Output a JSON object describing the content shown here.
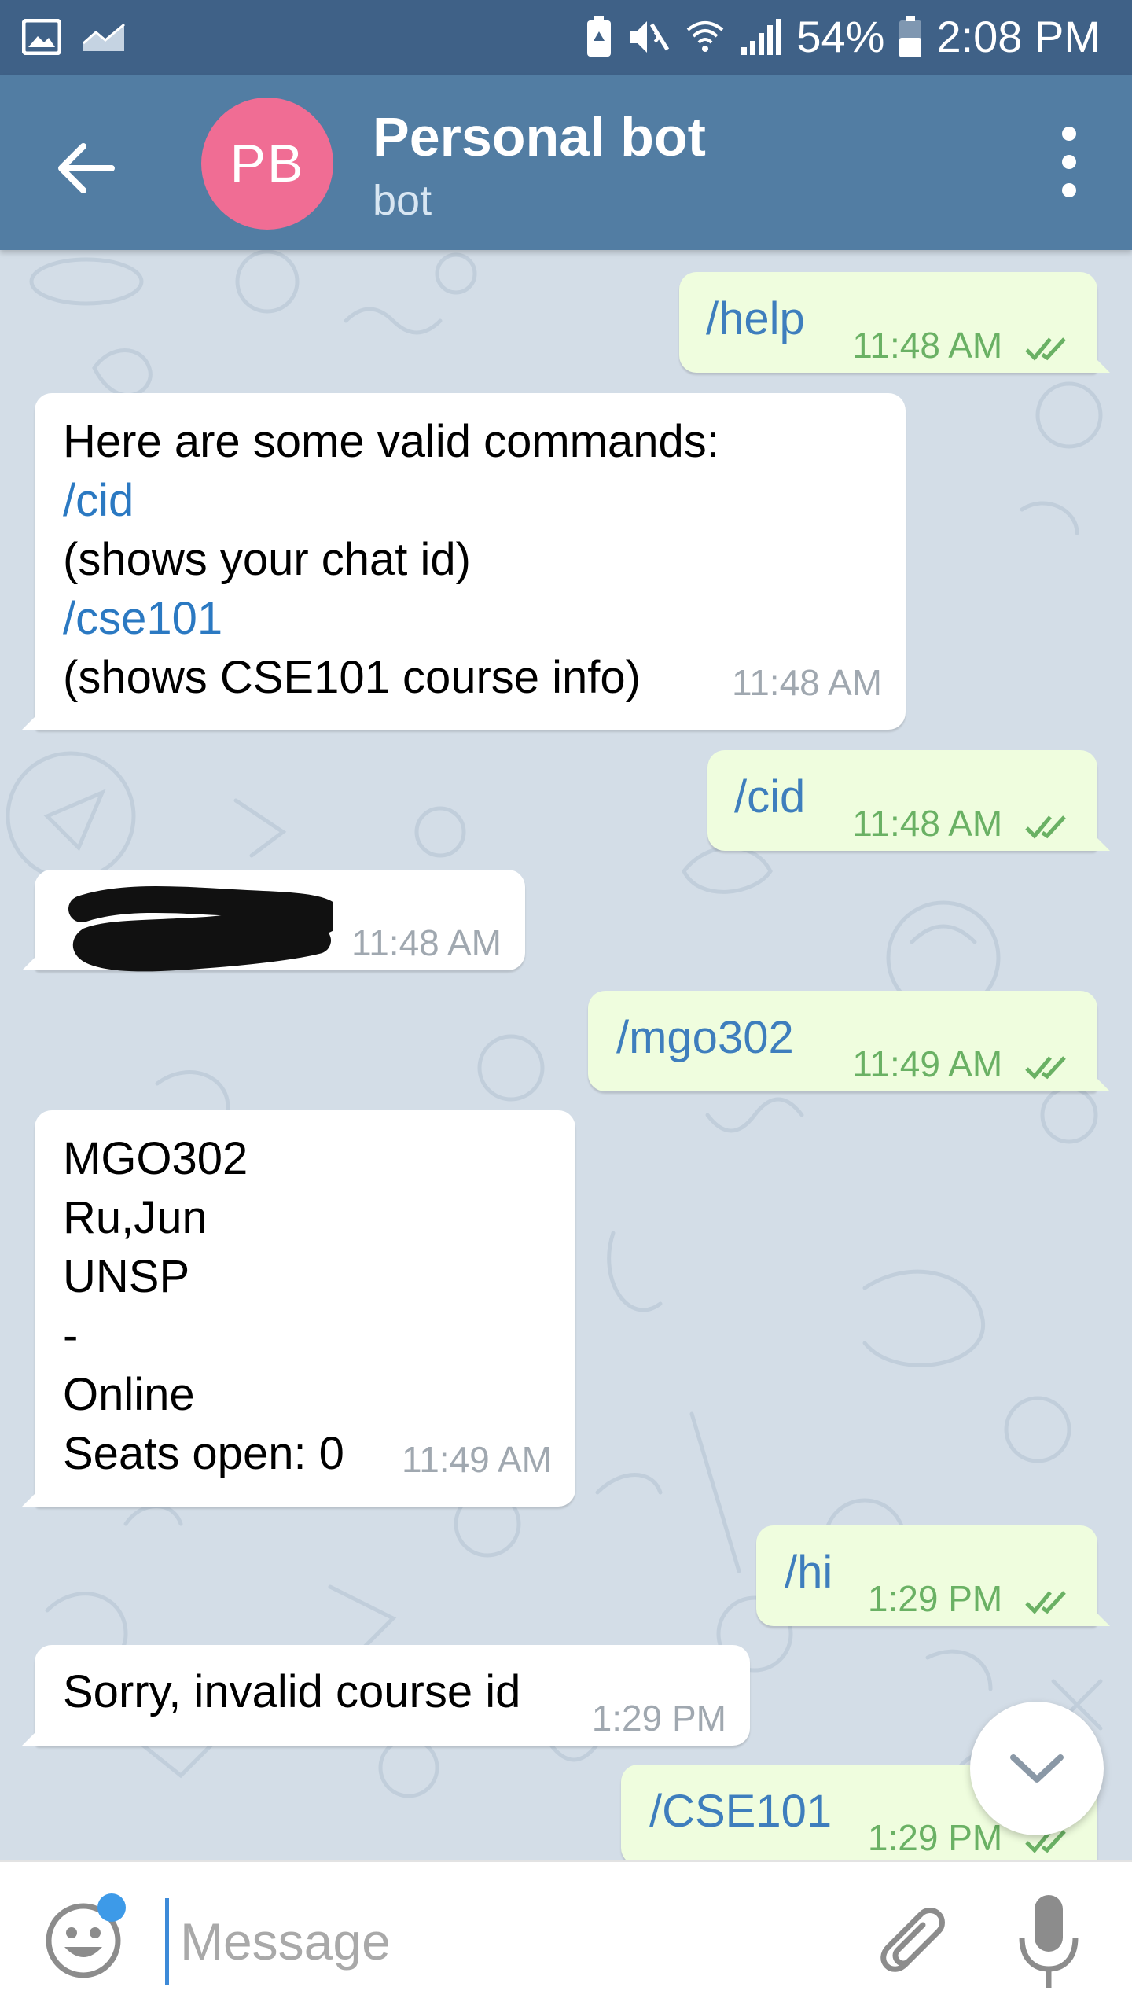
{
  "status_bar": {
    "battery_percent": "54%",
    "time": "2:08 PM",
    "icons": [
      "image-icon",
      "chart-icon",
      "battery-saver-icon",
      "mute-icon",
      "wifi-icon",
      "signal-icon",
      "battery-icon"
    ]
  },
  "toolbar": {
    "avatar_initials": "PB",
    "avatar_color": "#f06d94",
    "title": "Personal bot",
    "subtitle": "bot"
  },
  "messages": [
    {
      "dir": "out",
      "text": "/help",
      "time": "11:48 AM",
      "read": true
    },
    {
      "dir": "in",
      "lines": [
        {
          "text": "Here are some valid commands:",
          "link": false
        },
        {
          "text": "/cid",
          "link": true
        },
        {
          "text": "(shows your chat id)",
          "link": false
        },
        {
          "text": "/cse101",
          "link": true
        },
        {
          "text": "(shows CSE101 course info)",
          "link": false
        }
      ],
      "time": "11:48 AM"
    },
    {
      "dir": "out",
      "text": "/cid",
      "time": "11:48 AM",
      "read": true
    },
    {
      "dir": "in",
      "redacted": true,
      "time": "11:48 AM"
    },
    {
      "dir": "out",
      "text": "/mgo302",
      "time": "11:49 AM",
      "read": true
    },
    {
      "dir": "in",
      "lines": [
        {
          "text": "MGO302"
        },
        {
          "text": "Ru,Jun"
        },
        {
          "text": "UNSP"
        },
        {
          "text": "-"
        },
        {
          "text": "Online"
        },
        {
          "text": "Seats open: 0"
        }
      ],
      "time": "11:49 AM"
    },
    {
      "dir": "out",
      "text": "/hi",
      "time": "1:29 PM",
      "read": true
    },
    {
      "dir": "in",
      "lines": [
        {
          "text": "Sorry, invalid course id"
        }
      ],
      "time": "1:29 PM"
    },
    {
      "dir": "out",
      "text": "/CSE101",
      "time": "1:29 PM",
      "read": true
    }
  ],
  "input": {
    "placeholder": "Message",
    "value": ""
  },
  "colors": {
    "status_bar": "#3f6187",
    "toolbar": "#527da3",
    "chat_background": "#d3dde7",
    "outgoing_bubble": "#effdde",
    "incoming_bubble": "#ffffff",
    "link": "#2b79c2",
    "read_ticks": "#6ab164"
  }
}
